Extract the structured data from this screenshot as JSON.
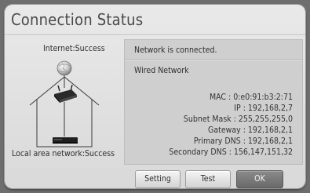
{
  "dialog": {
    "title": "Connection Status"
  },
  "diagram": {
    "internet_label": "Internet:Success",
    "lan_label": "Local area network:Success"
  },
  "info": {
    "status_message": "Network is connected.",
    "network_type": "Wired Network",
    "details": [
      {
        "label": "MAC",
        "value": "0:e0:91:b3:2:71",
        "text": "MAC : 0:e0:91:b3:2:71"
      },
      {
        "label": "IP",
        "value": "192,168,2,7",
        "text": "IP : 192,168,2,7"
      },
      {
        "label": "Subnet Mask",
        "value": "255,255,255,0",
        "text": "Subnet Mask : 255,255,255,0"
      },
      {
        "label": "Gateway",
        "value": "192,168,2,1",
        "text": "Gateway : 192,168,2,1"
      },
      {
        "label": "Primary DNS",
        "value": "192,168,2,1",
        "text": "Primary DNS : 192,168,2,1"
      },
      {
        "label": "Secondary DNS",
        "value": "156,147,151,32",
        "text": "Secondary DNS : 156,147,151,32"
      }
    ]
  },
  "buttons": {
    "setting": "Setting",
    "test": "Test",
    "ok": "OK"
  },
  "icons": [
    "globe-icon",
    "router-icon",
    "house-icon",
    "player-icon"
  ],
  "colors": {
    "background": "#6e6e6e",
    "dialog": "#e2e2e2",
    "panel": "#cfcfcf",
    "focused_button": "#7a7a7a"
  }
}
